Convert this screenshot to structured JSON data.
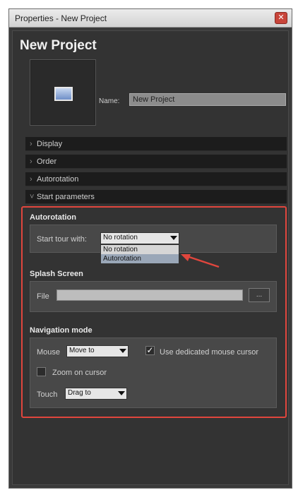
{
  "window": {
    "title": "Properties - New Project",
    "close_glyph": "✕"
  },
  "header": {
    "project_title": "New Project",
    "thumbnail_icon": "image-icon"
  },
  "name_field": {
    "label": "Name:",
    "value": "New Project"
  },
  "sections": [
    {
      "label": "Display"
    },
    {
      "label": "Order"
    },
    {
      "label": "Autorotation"
    },
    {
      "label": "Start parameters"
    }
  ],
  "start_parameters": {
    "autorotation": {
      "title": "Autorotation",
      "start_tour_label": "Start tour with:",
      "selected": "No rotation",
      "options": [
        "No rotation",
        "Autorotation"
      ]
    },
    "splash_screen": {
      "title": "Splash Screen",
      "file_label": "File",
      "browse_label": "..."
    },
    "navigation_mode": {
      "title": "Navigation mode",
      "mouse_label": "Mouse",
      "mouse_value": "Move to",
      "dedicated_cursor_label": "Use dedicated mouse cursor",
      "dedicated_cursor_checked": true,
      "zoom_cursor_label": "Zoom on cursor",
      "zoom_cursor_checked": false,
      "touch_label": "Touch",
      "touch_value": "Drag to"
    }
  },
  "colors": {
    "highlight": "#e0463d",
    "panel": "#3a3a3a"
  }
}
